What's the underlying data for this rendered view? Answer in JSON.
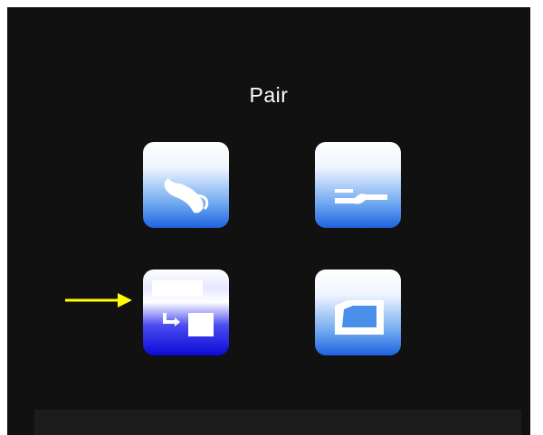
{
  "screen": {
    "title": "Pair"
  },
  "menu_tiles": [
    {
      "id": "setup",
      "icon": "wrench-icon",
      "state": "normal"
    },
    {
      "id": "connect",
      "icon": "plug-cable-icon",
      "state": "normal"
    },
    {
      "id": "pair",
      "icon": "pair-transfer-icon",
      "state": "selected"
    },
    {
      "id": "display",
      "icon": "screen-frame-icon",
      "state": "normal"
    }
  ],
  "pointer": {
    "icon": "arrow-right-icon",
    "color": "#ffff00"
  },
  "colors": {
    "background": "#111111",
    "text": "#ffffff",
    "tile_blue": "#1f62e0",
    "tile_selected_blue": "#0b0bd8"
  }
}
